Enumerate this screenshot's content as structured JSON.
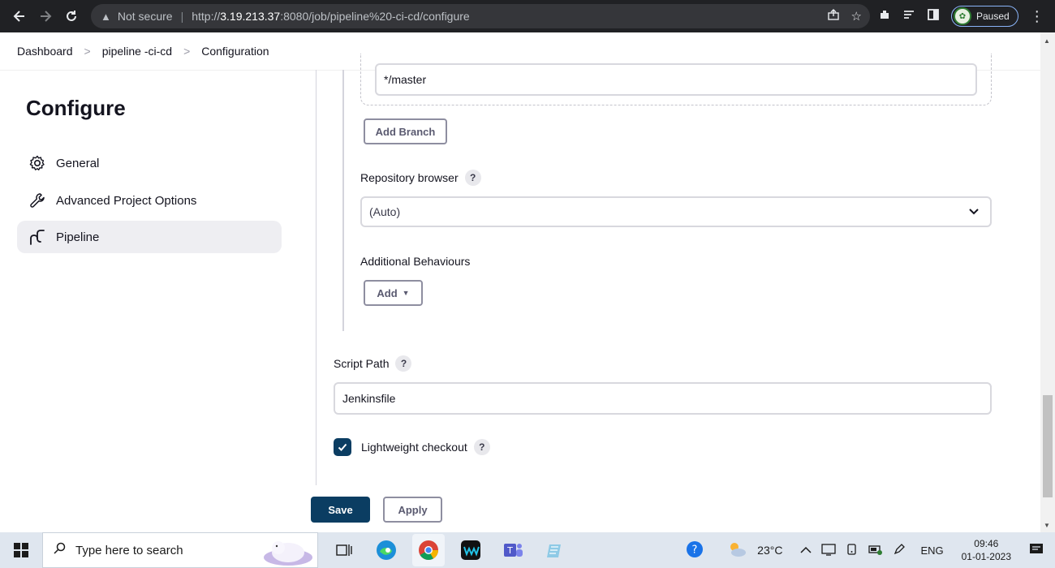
{
  "browser": {
    "security_label": "Not secure",
    "url_scheme": "http://",
    "url_host": "3.19.213.37",
    "url_rest": ":8080/job/pipeline%20-ci-cd/configure",
    "profile_status": "Paused"
  },
  "breadcrumb": {
    "items": [
      "Dashboard",
      "pipeline -ci-cd",
      "Configuration"
    ]
  },
  "sidebar": {
    "title": "Configure",
    "items": [
      {
        "label": "General",
        "icon": "gear-icon"
      },
      {
        "label": "Advanced Project Options",
        "icon": "wrench-icon"
      },
      {
        "label": "Pipeline",
        "icon": "pipeline-icon",
        "active": true
      }
    ]
  },
  "form": {
    "branch_specifier_value": "*/master",
    "add_branch_label": "Add Branch",
    "repository_browser_label": "Repository browser",
    "repository_browser_value": "(Auto)",
    "additional_behaviours_label": "Additional Behaviours",
    "add_label": "Add",
    "script_path_label": "Script Path",
    "script_path_value": "Jenkinsfile",
    "lightweight_checkout_label": "Lightweight checkout",
    "lightweight_checkout_checked": true,
    "help_glyph": "?"
  },
  "actions": {
    "save_label": "Save",
    "apply_label": "Apply"
  },
  "taskbar": {
    "search_placeholder": "Type here to search",
    "weather_temp": "23°C",
    "language": "ENG",
    "time": "09:46",
    "date": "01-01-2023"
  },
  "colors": {
    "primary": "#0b3d62",
    "chrome_bg": "#202124",
    "active_item_bg": "#eeeef2"
  }
}
